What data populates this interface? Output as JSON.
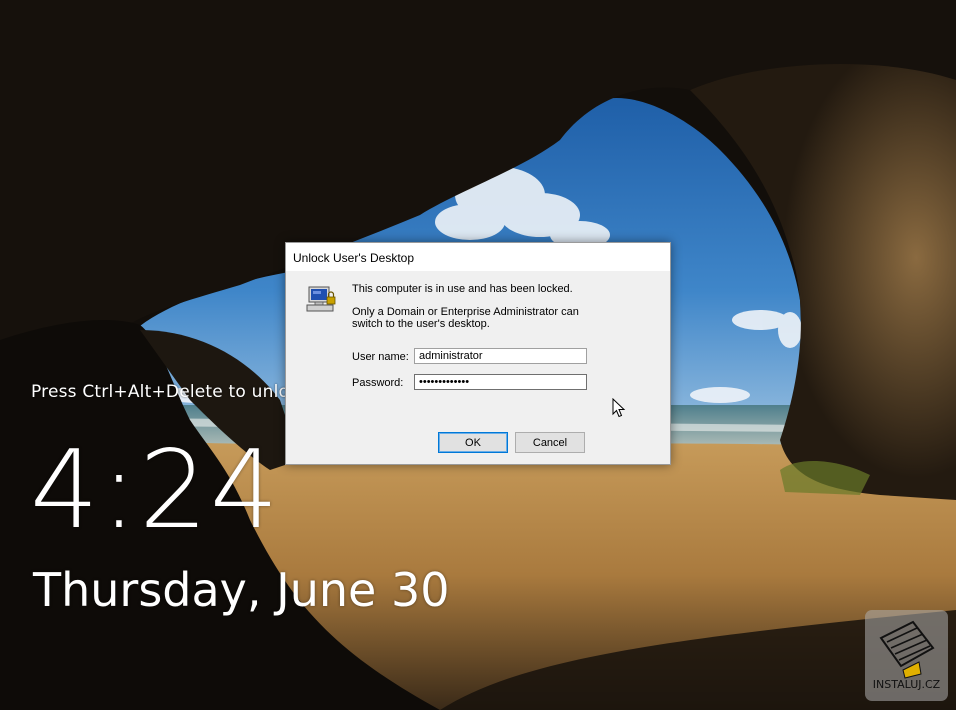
{
  "lock_screen": {
    "hint": "Press Ctrl+Alt+Delete to unlock",
    "time": "4:24",
    "date": "Thursday, June 30"
  },
  "dialog": {
    "title": "Unlock User's Desktop",
    "message_locked": "This computer is in use and has been locked.",
    "message_admin": "Only a Domain or Enterprise Administrator can switch to the user's desktop.",
    "user_label": "User name:",
    "user_value": "administrator",
    "password_label": "Password:",
    "password_mask": "•••••••••••••",
    "ok_label": "OK",
    "cancel_label": "Cancel",
    "icon": "locked-computer-icon"
  },
  "watermark": {
    "text": "INSTALUJ.CZ",
    "icon": "instaluj-logo-icon"
  },
  "colors": {
    "dialog_bg": "#f0f0f0",
    "titlebar_bg": "#ffffff",
    "focus_blue": "#0078d7",
    "sky": "#3a7fc4",
    "sand": "#b88a4a",
    "rock": "#1a140d"
  }
}
